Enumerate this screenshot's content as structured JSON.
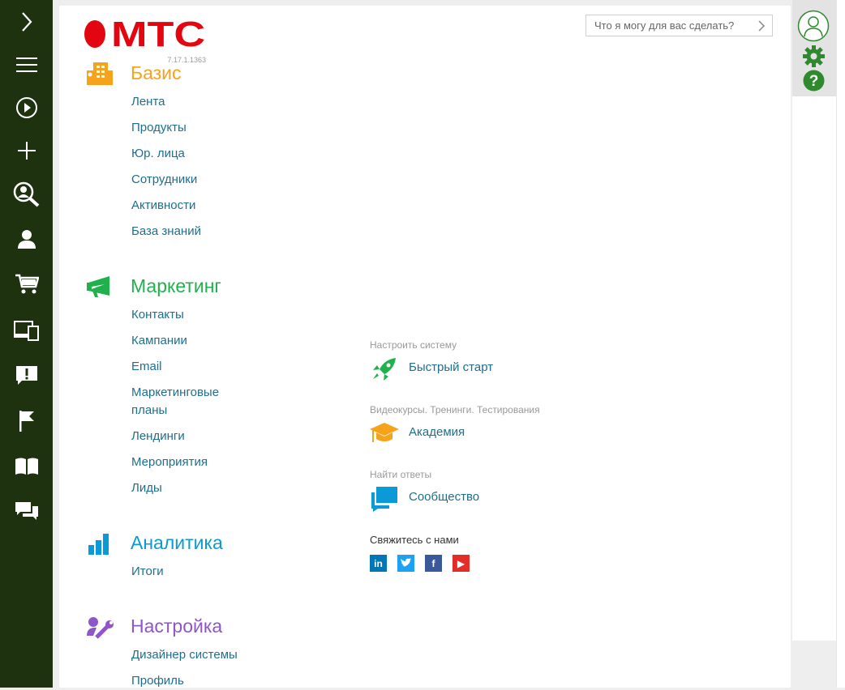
{
  "sidebar": {
    "items": [
      {
        "icon": "chevron-right-icon"
      },
      {
        "icon": "hamburger-menu-icon"
      },
      {
        "icon": "play-circle-icon"
      },
      {
        "icon": "plus-icon"
      },
      {
        "icon": "user-search-icon"
      },
      {
        "icon": "user-icon"
      },
      {
        "icon": "shopping-cart-icon"
      },
      {
        "icon": "devices-icon"
      },
      {
        "icon": "alert-message-icon"
      },
      {
        "icon": "flag-icon"
      },
      {
        "icon": "book-icon"
      },
      {
        "icon": "chat-icon"
      }
    ]
  },
  "header": {
    "logo_text": "МТС",
    "version": "7.17.1.1363",
    "search_placeholder": "Что я могу для вас сделать?"
  },
  "sections": {
    "basis": {
      "title": "Базис",
      "color": "#f7a21b",
      "items": [
        "Лента",
        "Продукты",
        "Юр. лица",
        "Сотрудники",
        "Активности",
        "База знаний"
      ]
    },
    "marketing": {
      "title": "Маркетинг",
      "color": "#20b14c",
      "items": [
        "Контакты",
        "Кампании",
        "Email",
        "Маркетинговые",
        "планы",
        "Лендинги",
        "Мероприятия",
        "Лиды"
      ]
    },
    "analytics": {
      "title": "Аналитика",
      "color": "#0a9ad7",
      "items": [
        "Итоги"
      ]
    },
    "settings": {
      "title": "Настройка",
      "color": "#8e56c8",
      "items": [
        "Дизайнер системы",
        "Профиль"
      ]
    }
  },
  "promo": {
    "setup_hint": "Настроить систему",
    "quickstart": "Быстрый старт",
    "academy_hint": "Видеокурсы. Тренинги. Тестирования",
    "academy": "Академия",
    "community_hint": "Найти ответы",
    "community": "Сообщество",
    "contact_title": "Свяжитесь с нами",
    "social": [
      {
        "name": "linkedin",
        "label": "in",
        "color": "#0077b5"
      },
      {
        "name": "twitter",
        "label": "t",
        "color": "#1da1f2"
      },
      {
        "name": "facebook",
        "label": "f",
        "color": "#3b5998"
      },
      {
        "name": "youtube",
        "label": "▶",
        "color": "#e52d27"
      }
    ]
  },
  "colors": {
    "sidebar": "#1e3210",
    "link": "#1f6e8c",
    "brand_red": "#e30611",
    "accent_green": "#2d8a2d"
  }
}
